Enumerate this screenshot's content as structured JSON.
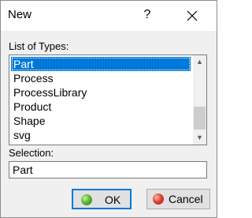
{
  "window": {
    "title": "New",
    "help_glyph": "?",
    "close_icon": "close-icon"
  },
  "types": {
    "label": "List of Types:",
    "items": [
      {
        "label": "Part",
        "selected": true
      },
      {
        "label": "Process",
        "selected": false
      },
      {
        "label": "ProcessLibrary",
        "selected": false
      },
      {
        "label": "Product",
        "selected": false
      },
      {
        "label": "Shape",
        "selected": false
      },
      {
        "label": "svg",
        "selected": false
      }
    ],
    "scroll_up_glyph": "▲",
    "scroll_down_glyph": "▼"
  },
  "selection": {
    "label": "Selection:",
    "value": "Part"
  },
  "buttons": {
    "ok_label": "OK",
    "cancel_label": "Cancel",
    "ok_icon": "green-ball-icon",
    "cancel_icon": "red-ball-icon"
  },
  "colors": {
    "selection_highlight": "#0078d7",
    "ok_icon": "#5cb82e",
    "cancel_icon": "#e0453a"
  }
}
